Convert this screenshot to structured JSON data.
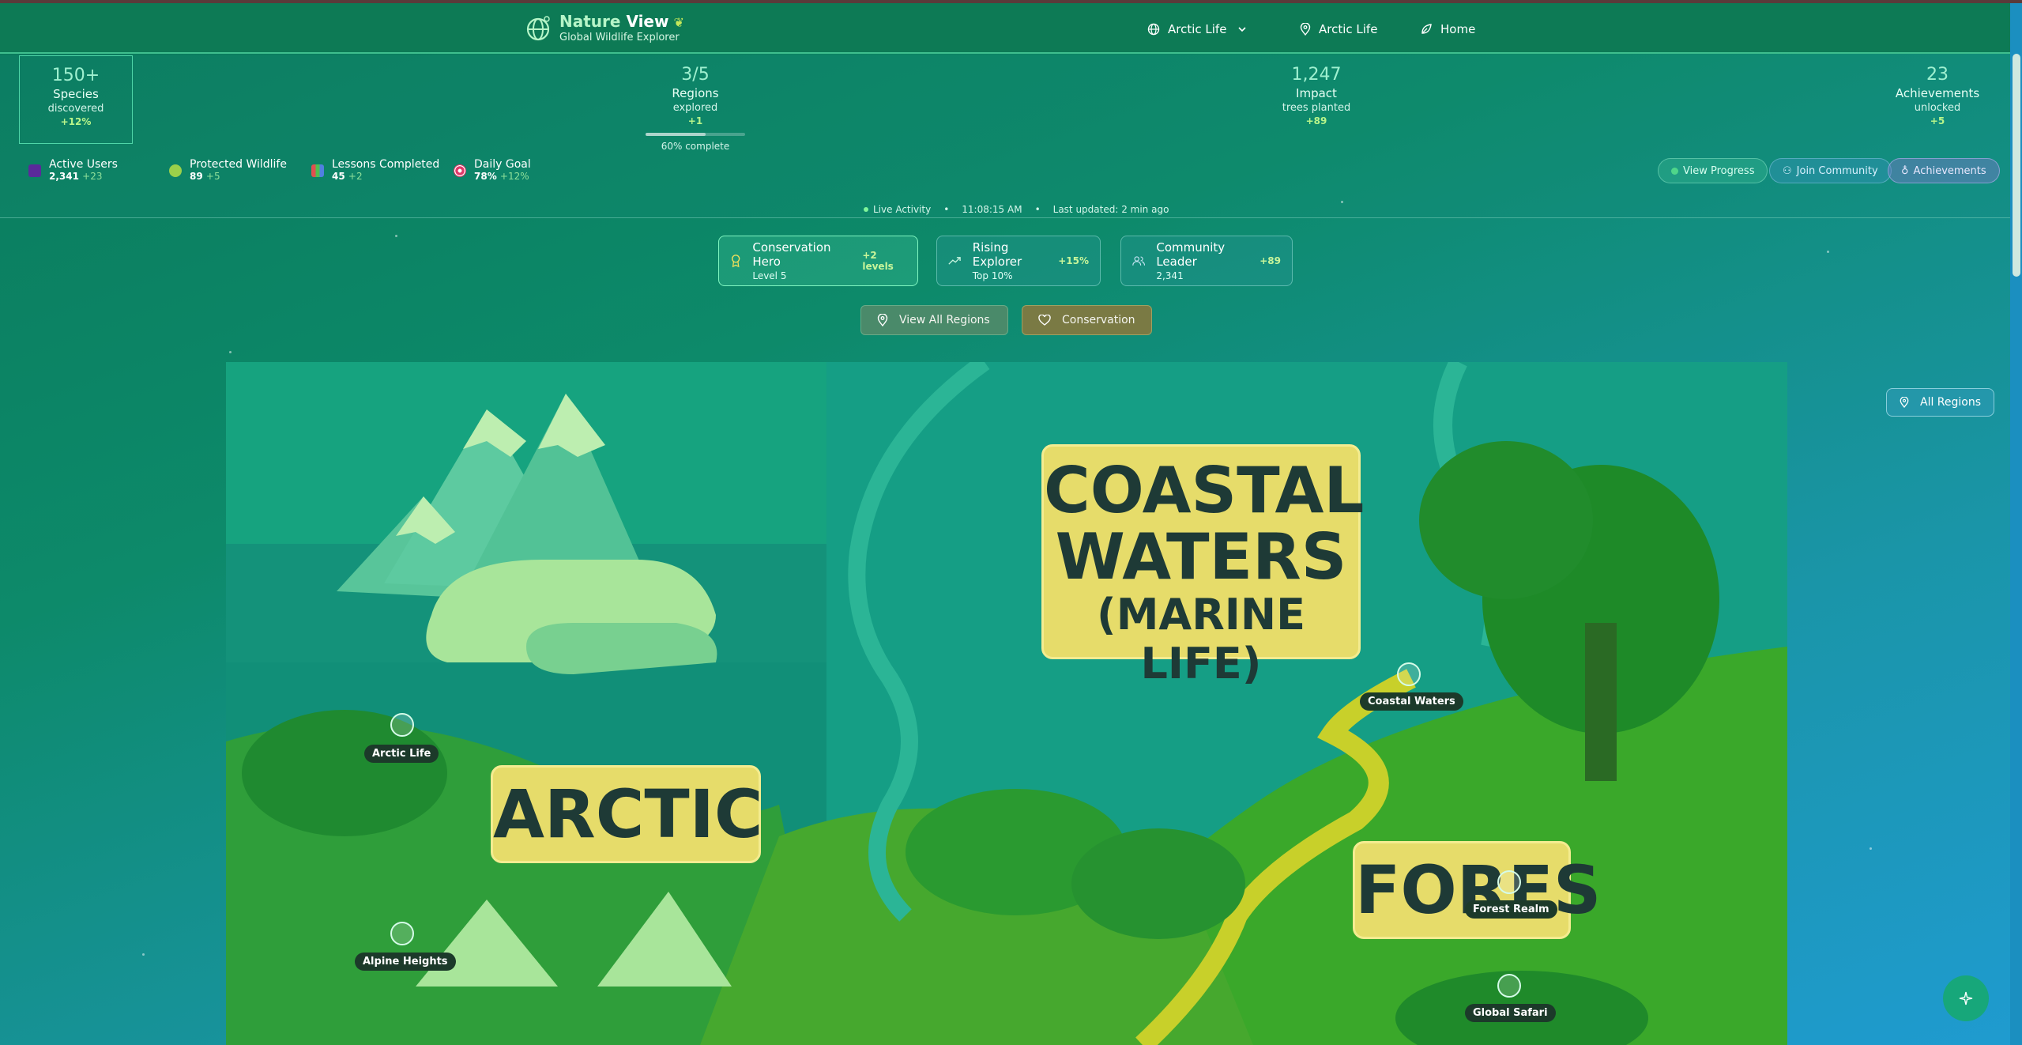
{
  "brand": {
    "title_light": "Nature",
    "title_strong": "View",
    "subtitle": "Global Wildlife Explorer"
  },
  "nav": {
    "dropdown_label": "Arctic Life",
    "location_label": "Arctic Life",
    "home_label": "Home"
  },
  "stats": [
    {
      "value": "150+",
      "label": "Species",
      "sub": "discovered",
      "delta": "+12%"
    },
    {
      "value": "3/5",
      "label": "Regions",
      "sub": "explored",
      "delta": "+1",
      "progress_text": "60% complete",
      "progress": 0.6
    },
    {
      "value": "1,247",
      "label": "Impact",
      "sub": "trees planted",
      "delta": "+89"
    },
    {
      "value": "23",
      "label": "Achievements",
      "sub": "unlocked",
      "delta": "+5"
    }
  ],
  "mini_stats": [
    {
      "label": "Active Users",
      "value": "2,341",
      "delta": "+23"
    },
    {
      "label": "Protected Wildlife",
      "value": "89",
      "delta": "+5"
    },
    {
      "label": "Lessons Completed",
      "value": "45",
      "delta": "+2"
    },
    {
      "label": "Daily Goal",
      "value": "78%",
      "delta": "+12%"
    }
  ],
  "quick_buttons": {
    "progress": "View Progress",
    "community": "Join Community",
    "achievements": "Achievements"
  },
  "live": {
    "label": "Live Activity",
    "time": "11:08:15 AM",
    "updated": "Last updated: 2 min ago"
  },
  "achievements": [
    {
      "title": "Conservation Hero",
      "sub": "Level 5",
      "delta": "+2 levels"
    },
    {
      "title": "Rising Explorer",
      "sub": "Top 10%",
      "delta": "+15%"
    },
    {
      "title": "Community Leader",
      "sub": "2,341",
      "delta": "+89"
    }
  ],
  "actions": {
    "regions": "View All Regions",
    "conservation": "Conservation"
  },
  "map": {
    "signs": {
      "coastal_1": "COASTAL",
      "coastal_2": "WATERS",
      "coastal_3": "(MARINE LIFE)",
      "arctic": "ARCTIC",
      "forest": "FORES"
    },
    "markers": [
      "Arctic Life",
      "Coastal Waters",
      "Alpine Heights",
      "Forest Realm",
      "Global Safari"
    ]
  },
  "all_regions_label": "All Regions",
  "colors": {
    "navbar": "#0d7a55",
    "accent": "#3fbf8e",
    "sign": "#e6dc6a"
  }
}
